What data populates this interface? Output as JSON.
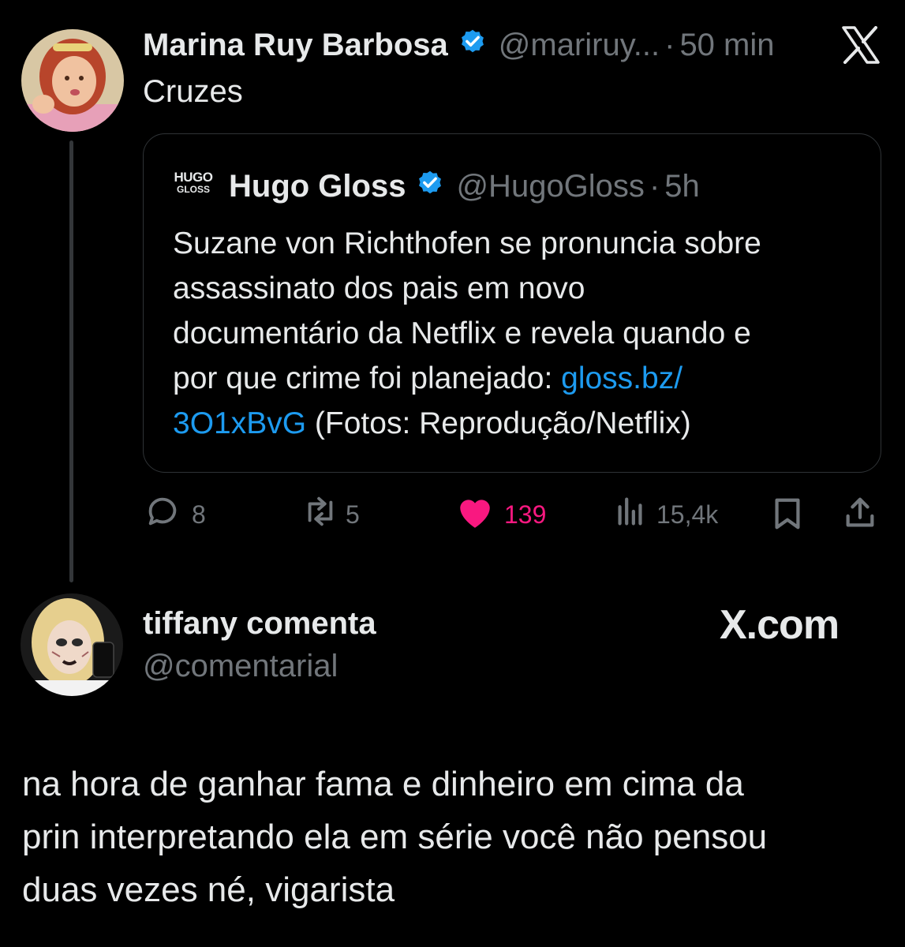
{
  "main_tweet": {
    "display_name": "Marina Ruy Barbosa",
    "handle": "@mariruy...",
    "separator": "·",
    "time": "50 min",
    "text": "Cruzes"
  },
  "quoted_tweet": {
    "logo_top": "HUGO",
    "logo_bottom": "GLOSS",
    "display_name": "Hugo Gloss",
    "handle": "@HugoGloss",
    "separator": "·",
    "time": "5h",
    "text_lines": [
      "Suzane von Richthofen se pronuncia sobre",
      "assassinato dos pais em novo",
      "documentário da Netflix e revela quando e"
    ],
    "line4_prefix": "por que crime foi planejado: ",
    "link_part1": "gloss.bz/",
    "link_part2": "3O1xBvG",
    "line5_suffix": " (Fotos: Reprodução/Netflix)"
  },
  "actions": {
    "replies": "8",
    "retweets": "5",
    "likes": "139",
    "views": "15,4k"
  },
  "reply_card": {
    "display_name": "tiffany comenta",
    "handle": "@comentarial",
    "brand": "X.com",
    "text_lines": [
      "na hora de ganhar fama e dinheiro em cima da",
      "prin interpretando ela em série você não pensou",
      "duas vezes né, vigarista"
    ]
  },
  "colors": {
    "background": "#000000",
    "verified": "#1d9bf0",
    "link": "#1d9bf0",
    "like": "#f91880",
    "muted": "#71767b"
  },
  "icons": [
    "x-logo-icon",
    "verified-badge-icon",
    "reply-icon",
    "retweet-icon",
    "heart-icon",
    "views-icon",
    "bookmark-icon",
    "share-icon"
  ]
}
